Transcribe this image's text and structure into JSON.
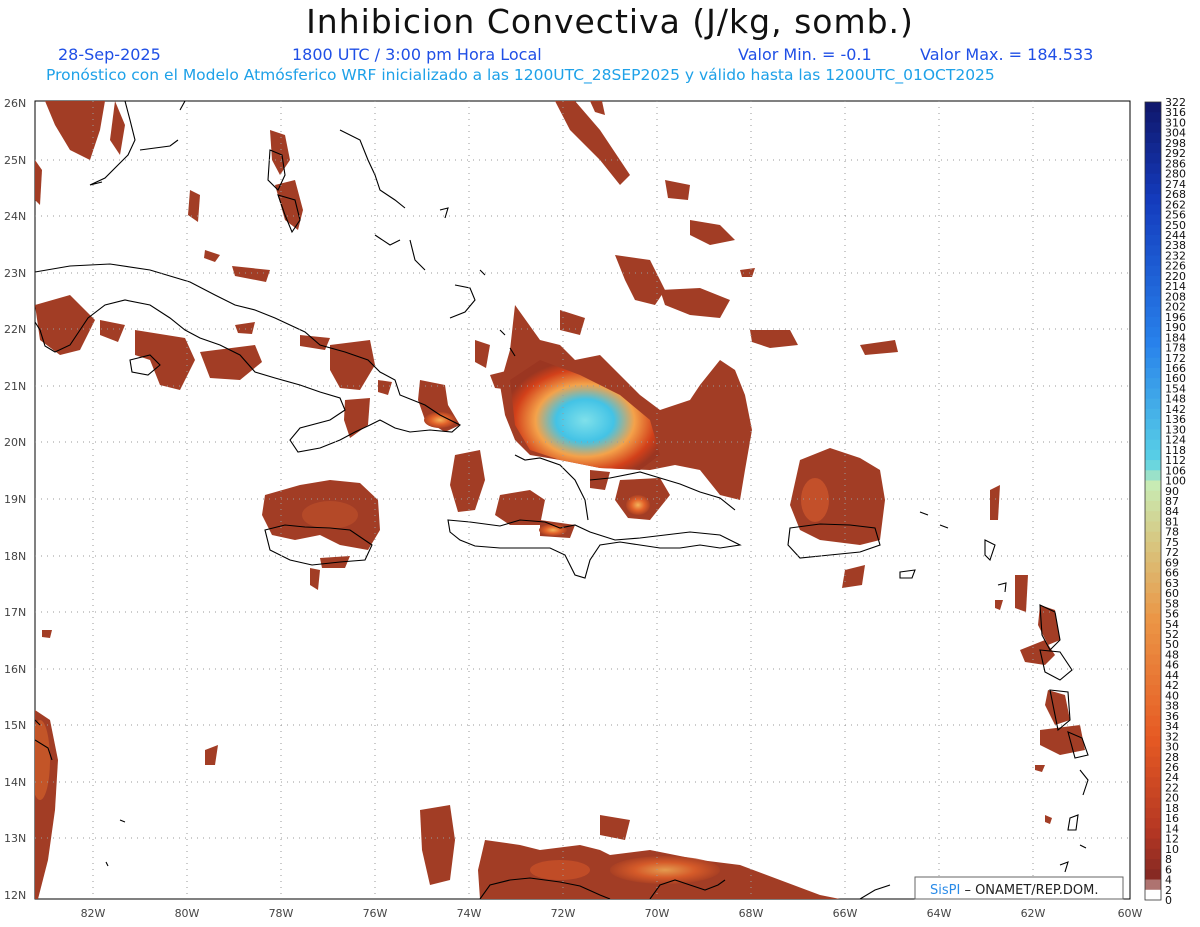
{
  "header": {
    "title": "Inhibicion Convectiva (J/kg, somb.)",
    "date": "28-Sep-2025",
    "time": "1800 UTC / 3:00 pm Hora Local",
    "valmin": "Valor Min. = -0.1",
    "valmax": "Valor Max. = 184.533",
    "subtitle": "Pronóstico con el Modelo Atmósferico WRF inicializado a las 1200UTC_28SEP2025 y válido hasta las  1200UTC_01OCT2025"
  },
  "map": {
    "lat_labels": [
      "26N",
      "25N",
      "24N",
      "23N",
      "22N",
      "21N",
      "20N",
      "19N",
      "18N",
      "17N",
      "16N",
      "15N",
      "14N",
      "13N",
      "12N"
    ],
    "lon_labels": [
      "82W",
      "80W",
      "78W",
      "76W",
      "74W",
      "72W",
      "70W",
      "68W",
      "66W",
      "64W",
      "62W",
      "60W"
    ],
    "credit_brand": "SisPI",
    "credit_text": " – ONAMET/REP.DOM."
  },
  "colorbar": {
    "labels": [
      "322",
      "316",
      "310",
      "304",
      "298",
      "292",
      "286",
      "280",
      "274",
      "268",
      "262",
      "256",
      "250",
      "244",
      "238",
      "232",
      "226",
      "220",
      "214",
      "208",
      "202",
      "196",
      "190",
      "184",
      "178",
      "172",
      "166",
      "160",
      "154",
      "148",
      "142",
      "136",
      "130",
      "124",
      "118",
      "112",
      "106",
      "100",
      "90",
      "87",
      "84",
      "81",
      "78",
      "75",
      "72",
      "69",
      "66",
      "63",
      "60",
      "58",
      "56",
      "54",
      "52",
      "50",
      "48",
      "46",
      "44",
      "42",
      "40",
      "38",
      "36",
      "34",
      "32",
      "30",
      "28",
      "26",
      "24",
      "22",
      "20",
      "18",
      "16",
      "14",
      "12",
      "10",
      "8",
      "6",
      "4",
      "2",
      "0"
    ]
  }
}
